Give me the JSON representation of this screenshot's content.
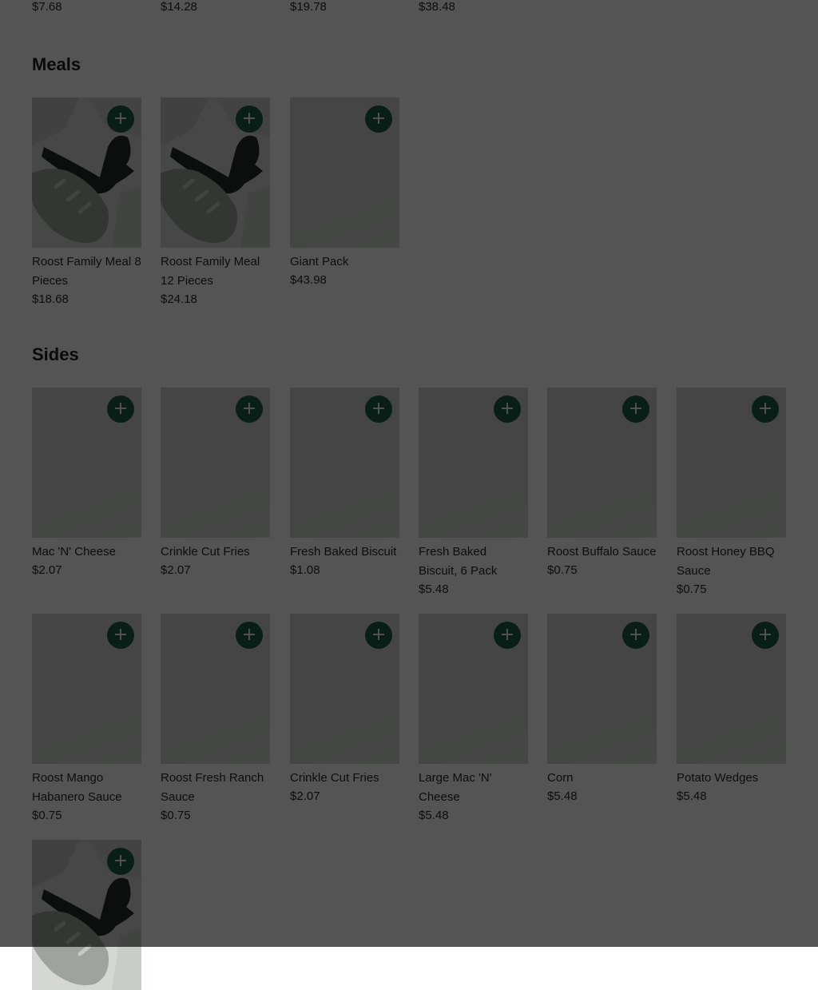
{
  "top_row_prices": [
    "$7.68",
    "$14.28",
    "$19.78",
    "$38.48"
  ],
  "sections": {
    "meals": {
      "title": "Meals",
      "items": [
        {
          "name": "Roost Family Meal 8 Pieces",
          "price": "$18.68",
          "image": "chicken-biscuit-illustration"
        },
        {
          "name": "Roost Family Meal 12 Pieces",
          "price": "$24.18",
          "image": "chicken-biscuit-illustration"
        },
        {
          "name": "Giant Pack",
          "price": "$43.98",
          "image": "blank"
        }
      ]
    },
    "sides": {
      "title": "Sides",
      "items": [
        {
          "name": "Mac 'N' Cheese",
          "price": "$2.07",
          "image": "blank"
        },
        {
          "name": "Crinkle Cut Fries",
          "price": "$2.07",
          "image": "blank"
        },
        {
          "name": "Fresh Baked Biscuit",
          "price": "$1.08",
          "image": "blank"
        },
        {
          "name": "Fresh Baked Biscuit, 6 Pack",
          "price": "$5.48",
          "image": "blank"
        },
        {
          "name": "Roost Buffalo Sauce",
          "price": "$0.75",
          "image": "blank"
        },
        {
          "name": "Roost Honey BBQ Sauce",
          "price": "$0.75",
          "image": "blank"
        },
        {
          "name": "Roost Mango Habanero Sauce",
          "price": "$0.75",
          "image": "blank"
        },
        {
          "name": "Roost Fresh Ranch Sauce",
          "price": "$0.75",
          "image": "blank"
        },
        {
          "name": "Crinkle Cut Fries",
          "price": "$2.07",
          "image": "blank"
        },
        {
          "name": "Large Mac 'N' Cheese",
          "price": "$5.48",
          "image": "blank"
        },
        {
          "name": "Corn",
          "price": "$5.48",
          "image": "blank"
        },
        {
          "name": "Potato Wedges",
          "price": "$5.48",
          "image": "blank"
        },
        {
          "name": "",
          "price": "",
          "image": "chicken-biscuit-illustration"
        }
      ]
    }
  },
  "add_button": {
    "icon": "plus-icon",
    "glyph": "+"
  },
  "colors": {
    "accent": "#1d5c45",
    "overlay": "rgba(0,0,0,0.67)"
  }
}
